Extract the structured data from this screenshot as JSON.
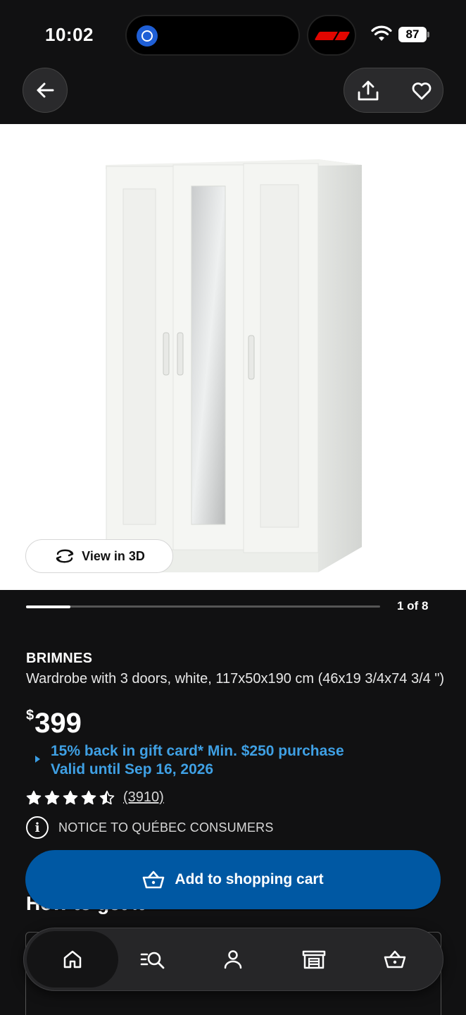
{
  "status_bar": {
    "time": "10:02",
    "battery": "87",
    "icons": [
      "dynamic-island-app-icon",
      "f1-logo-icon",
      "wifi-icon",
      "battery-icon"
    ]
  },
  "top_nav": {
    "icons": [
      "back-arrow-icon",
      "share-icon",
      "heart-icon"
    ]
  },
  "product_image": {
    "view_3d_label": "View in 3D",
    "icon": "rotate-3d-icon"
  },
  "pager": {
    "label": "1 of 8",
    "current": 1,
    "total": 8
  },
  "product": {
    "brand": "BRIMNES",
    "description": "Wardrobe with 3 doors, white, 117x50x190 cm (46x19 3/4x74 3/4 \")",
    "price_currency": "$",
    "price_amount": "399",
    "promo_line1": "15% back in gift card* Min. $250 purchase",
    "promo_line2": "Valid until Sep 16, 2026",
    "rating": 4.5,
    "rating_max": 5,
    "review_count": "(3910)",
    "notice": "NOTICE TO QUÉBEC CONSUMERS"
  },
  "section": {
    "how_to_get": "How to get it"
  },
  "cart_button": {
    "label": "Add to shopping cart",
    "icon": "basket-icon"
  },
  "tab_bar": {
    "tabs": [
      {
        "icon": "home-icon",
        "active": true
      },
      {
        "icon": "search-list-icon",
        "active": false
      },
      {
        "icon": "profile-icon",
        "active": false
      },
      {
        "icon": "store-icon",
        "active": false
      },
      {
        "icon": "basket-icon",
        "active": false
      }
    ]
  },
  "colors": {
    "background": "#111112",
    "accent_blue": "#0058a3",
    "promo_blue": "#3fa0e4"
  }
}
